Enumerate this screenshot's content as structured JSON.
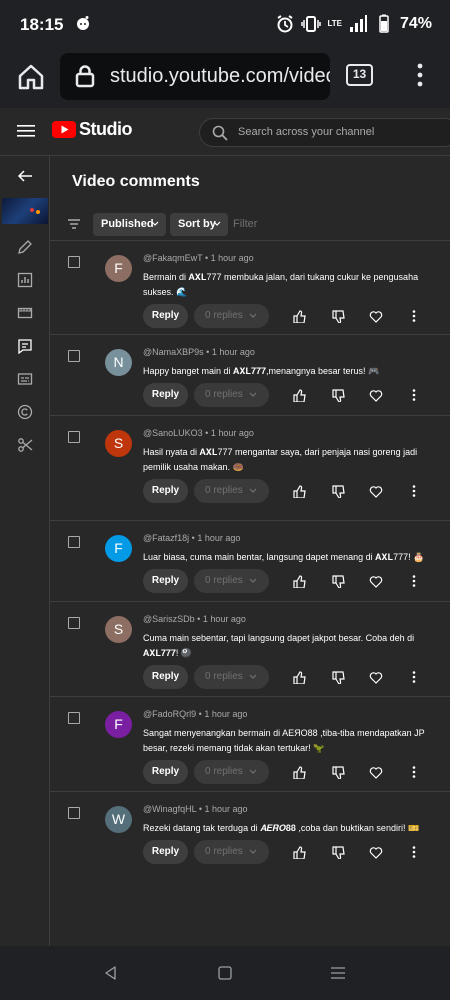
{
  "status": {
    "time": "18:15",
    "battery": "74%",
    "network": "LTE"
  },
  "browser": {
    "url": "studio.youtube.com/video",
    "tab_count": "13"
  },
  "studio": {
    "logo_text": "Studio",
    "search_placeholder": "Search across your channel"
  },
  "page": {
    "title": "Video comments",
    "chip_published": "Published",
    "chip_sort": "Sort by",
    "filter_placeholder": "Filter"
  },
  "labels": {
    "reply": "Reply",
    "replies": "0 replies"
  },
  "comments": [
    {
      "author": "@FakaqmEwT",
      "time": "1 hour ago",
      "initial": "F",
      "color": "#8d6e63",
      "text": "Bermain di 𝐀𝐗𝐋777 membuka jalan, dari tukang cukur ke pengusaha sukses. 🌊"
    },
    {
      "author": "@NamaXBP9s",
      "time": "1 hour ago",
      "initial": "N",
      "color": "#78909c",
      "text": "Happy banget main di 𝐀𝐗𝐋𝟕𝟕𝟕,menangnya besar terus! 🎮"
    },
    {
      "author": "@SanoLUKO3",
      "time": "1 hour ago",
      "initial": "S",
      "color": "#bf360c",
      "text": "Hasil nyata di 𝐀𝐗𝐋777 mengantar saya, dari penjaja nasi goreng jadi pemilik usaha makan. 🍩"
    },
    {
      "author": "@Fatazf18j",
      "time": "1 hour ago",
      "initial": "F",
      "color": "#039be5",
      "text": "Luar biasa, cuma main bentar, langsung dapet menang di 𝐀𝐗𝐋777! 🎂"
    },
    {
      "author": "@SariszSDb",
      "time": "1 hour ago",
      "initial": "S",
      "color": "#8d6e63",
      "text": "Cuma main sebentar, tapi langsung dapet jakpot besar. Coba deh di 𝐀𝐗𝐋𝟕𝟕𝟕! 🎱"
    },
    {
      "author": "@FadoRQrl9",
      "time": "1 hour ago",
      "initial": "F",
      "color": "#7b1fa2",
      "text": "Sangat menyenangkan bermain di AEЯO88 ,tiba-tiba mendapatkan JP besar, rezeki memang tidak akan tertukar! 🦖"
    },
    {
      "author": "@WinagfqHL",
      "time": "1 hour ago",
      "initial": "W",
      "color": "#546e7a",
      "text": "Rezeki datang tak terduga di 𝑨𝑬𝑹𝑶𝟖𝟖 ,coba dan buktikan sendiri! 🎫"
    }
  ]
}
